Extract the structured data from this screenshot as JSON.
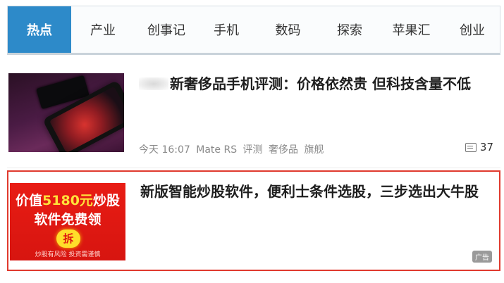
{
  "nav": {
    "tabs": [
      "热点",
      "产业",
      "创事记",
      "手机",
      "数码",
      "探索",
      "苹果汇",
      "创业"
    ],
    "active_color": "#2d8ac9"
  },
  "articles": [
    {
      "title": "新奢侈品手机评测：价格依然贵 但科技含量不低",
      "time": "今天 16:07",
      "tags": [
        "Mate RS",
        "评测",
        "奢侈品",
        "旗舰"
      ],
      "comments": "37",
      "thumbnail_icon": "phone-photo"
    }
  ],
  "ad": {
    "title": "新版智能炒股软件，便利士条件选股，三步选出大牛股",
    "image_text_prefix": "价值",
    "image_text_highlight": "5180元",
    "image_text_suffix": "炒股",
    "image_text_line2": "软件免费领",
    "image_button": "拆",
    "image_disclaimer": "炒股有风险 投资需谨慎",
    "tag": "广告",
    "border_color": "#e03a2e"
  }
}
